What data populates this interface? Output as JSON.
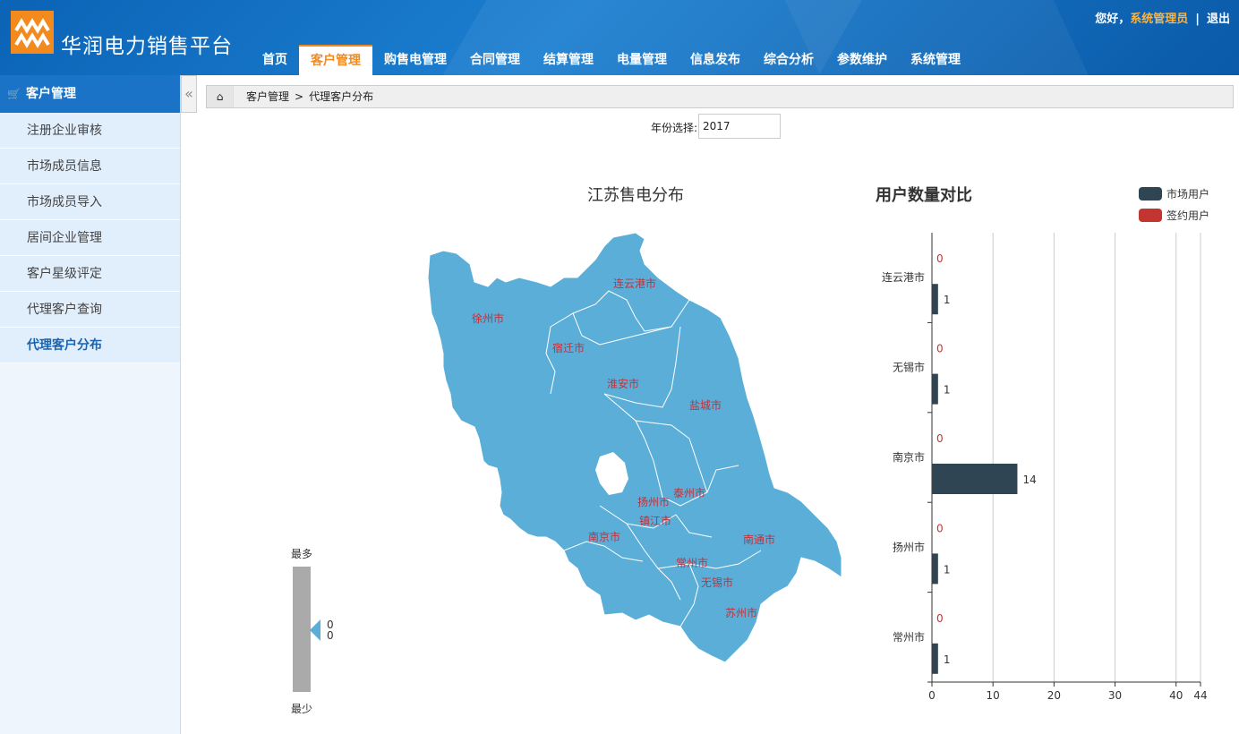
{
  "header": {
    "brand": "华润电力销售平台",
    "greeting": "您好，",
    "username": "系统管理员",
    "separator": "|",
    "logout": "退出",
    "nav": [
      "首页",
      "客户管理",
      "购售电管理",
      "合同管理",
      "结算管理",
      "电量管理",
      "信息发布",
      "综合分析",
      "参数维护",
      "系统管理"
    ],
    "active_nav": "客户管理"
  },
  "sidebar": {
    "title": "客户管理",
    "items": [
      "注册企业审核",
      "市场成员信息",
      "市场成员导入",
      "居间企业管理",
      "客户星级评定",
      "代理客户查询",
      "代理客户分布"
    ],
    "active_item": "代理客户分布"
  },
  "breadcrumb": {
    "parent": "客户管理",
    "separator": ">",
    "current": "代理客户分布"
  },
  "filter": {
    "year_label": "年份选择:",
    "year_value": "2017"
  },
  "map": {
    "title": "江苏售电分布",
    "fill_color": "#5aaed8",
    "cities": [
      "连云港市",
      "徐州市",
      "宿迁市",
      "淮安市",
      "盐城市",
      "扬州市",
      "泰州市",
      "镇江市",
      "南京市",
      "南通市",
      "常州市",
      "无锡市",
      "苏州市"
    ],
    "scale_max_label": "最多",
    "scale_min_label": "最少",
    "scale_values": [
      "0",
      "0"
    ]
  },
  "chart_data": {
    "type": "bar",
    "orientation": "horizontal",
    "title": "用户数量对比",
    "categories": [
      "连云港市",
      "无锡市",
      "南京市",
      "扬州市",
      "常州市"
    ],
    "series": [
      {
        "name": "市场用户",
        "color": "#2f4554",
        "values": [
          1,
          1,
          14,
          1,
          1
        ]
      },
      {
        "name": "签约用户",
        "color": "#c23531",
        "values": [
          0,
          0,
          0,
          0,
          0
        ]
      }
    ],
    "xlim": [
      0,
      44
    ],
    "x_ticks": [
      0,
      10,
      20,
      30,
      40,
      44
    ],
    "legend_position": "top-right",
    "grid": true
  }
}
